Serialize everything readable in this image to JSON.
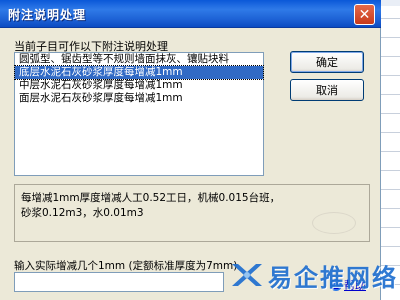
{
  "window": {
    "title": "附注说明处理",
    "close_symbol": "✕"
  },
  "list": {
    "label": "当前子目可作以下附注说明处理",
    "items": [
      "圆弧型、锯齿型等不规则墙面抹灰、镶贴块料",
      "底层水泥石灰砂浆厚度每增减1mm",
      "中层水泥石灰砂浆厚度每增减1mm",
      "面层水泥石灰砂浆厚度每增减1mm"
    ],
    "selected_index": 1
  },
  "buttons": {
    "ok": "确定",
    "cancel": "取消"
  },
  "description": {
    "line1": "每增减1mm厚度增减人工0.52工日，机械0.015台班，",
    "line2": "砂浆0.12m3，水0.01m3"
  },
  "input": {
    "label": "输入实际增减几个1mm (定额标准厚度为7mm)",
    "value": ""
  },
  "help": {
    "label": "帮助"
  },
  "watermark": {
    "text": "易企推网络"
  },
  "colors": {
    "titlebar": "#1e63d6",
    "selection": "#316ac5",
    "dialog_bg": "#ece9d8",
    "watermark": "#1f6fd0"
  }
}
